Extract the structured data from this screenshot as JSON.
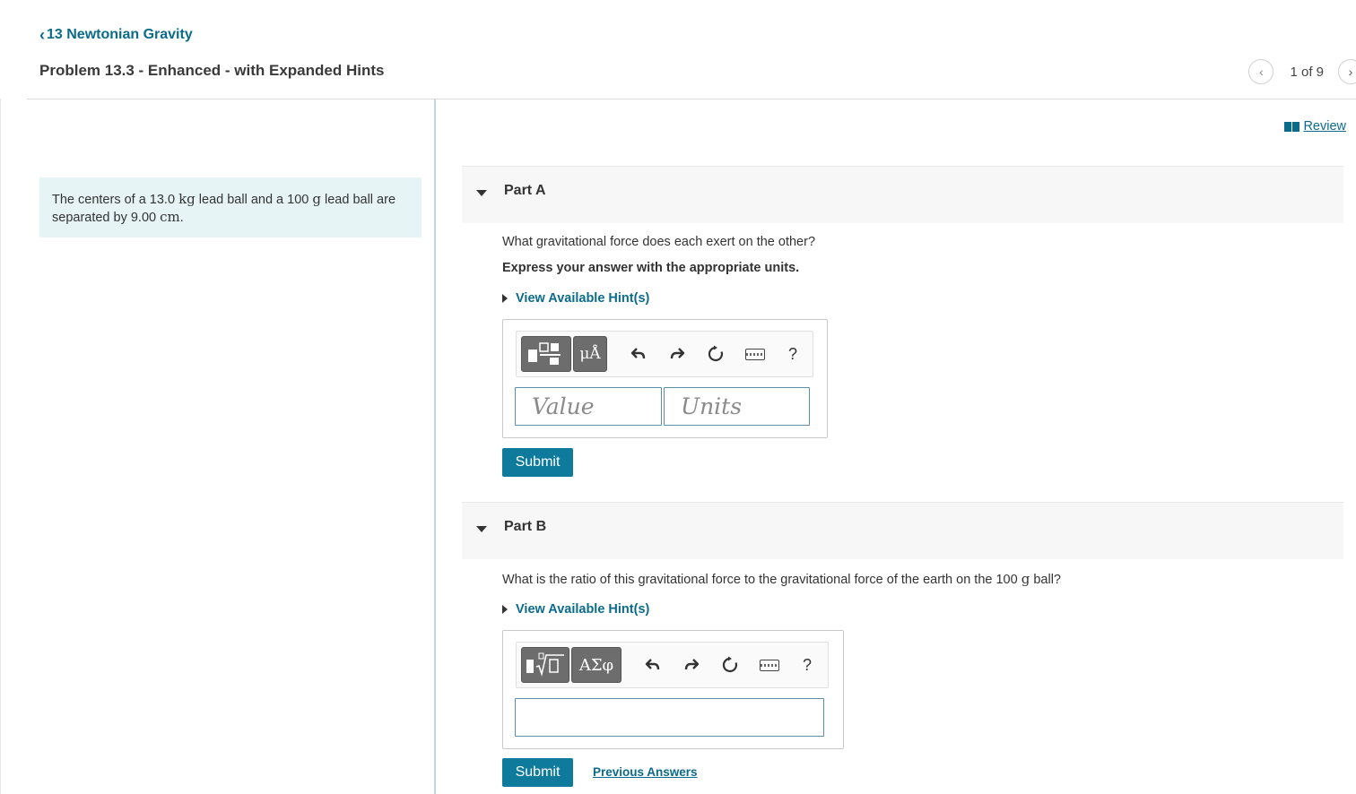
{
  "header": {
    "back_chevron": "‹",
    "back_label": "13 Newtonian Gravity",
    "problem_title": "Problem 13.3 - Enhanced - with Expanded Hints",
    "pager": {
      "prev": "‹",
      "text": "1 of 9",
      "next": "›"
    }
  },
  "review": {
    "label": "Review"
  },
  "context": {
    "p1": "The centers of a 13.0 ",
    "u1": "kg",
    "p2": " lead ball and a 100 ",
    "u2": "g",
    "p3": " lead ball are separated by 9.00 ",
    "u3": "cm",
    "p4": "."
  },
  "partA": {
    "label": "Part A",
    "question": "What gravitational force does each exert on the other?",
    "instruction": "Express your answer with the appropriate units.",
    "hint_label": "View Available Hint(s)",
    "units_button": "μÅ",
    "help": "?",
    "value_placeholder": "Value",
    "units_placeholder": "Units",
    "submit": "Submit"
  },
  "partB": {
    "label": "Part B",
    "question_pre": "What is the ratio of this gravitational force to the gravitational force of the earth on the 100 ",
    "question_unit": "g",
    "question_post": " ball?",
    "hint_label": "View Available Hint(s)",
    "greek_button": "ΑΣφ",
    "help": "?",
    "submit": "Submit",
    "previous_answers": "Previous Answers"
  }
}
